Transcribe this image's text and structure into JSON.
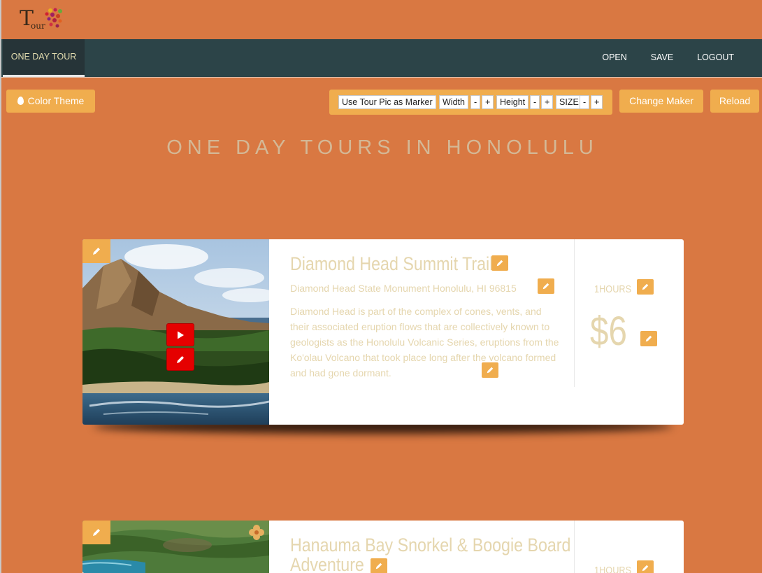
{
  "logo": {
    "letter": "T",
    "text": "our"
  },
  "nav": {
    "active_tab": "ONE DAY TOUR",
    "links": [
      "OPEN",
      "SAVE",
      "LOGOUT"
    ]
  },
  "toolbar": {
    "color_theme": "Color Theme",
    "use_tour_pic": "Use Tour Pic as Marker",
    "width": "Width",
    "height": "Height",
    "size": "SIZE",
    "minus": "-",
    "plus": "+",
    "change_maker": "Change Maker",
    "reload": "Reload"
  },
  "page_title": "ONE DAY TOURS IN HONOLULU",
  "tours": [
    {
      "name": "Diamond Head Summit Trail",
      "address": "Diamond Head State Monument Honolulu, HI 96815",
      "description": "Diamond Head is part of the complex of cones, vents, and their associated eruption flows that are collectively known to geologists as the Honolulu Volcanic Series, eruptions from the Ko'olau Volcano that took place long after the volcano formed and had gone dormant.",
      "duration": "1HOURS",
      "price": "$6"
    },
    {
      "name": "Hanauma Bay Snorkel & Boogie Board Adventure",
      "name_line1": "Hanauma Bay Snorkel & Boogie Board",
      "name_line2": "Adventure",
      "duration": "1HOURS"
    }
  ],
  "colors": {
    "background": "#d97842",
    "navbar": "#2c4448",
    "accent": "#f0ad4e",
    "text_muted": "#e5d6ae",
    "video": "#e50000"
  }
}
